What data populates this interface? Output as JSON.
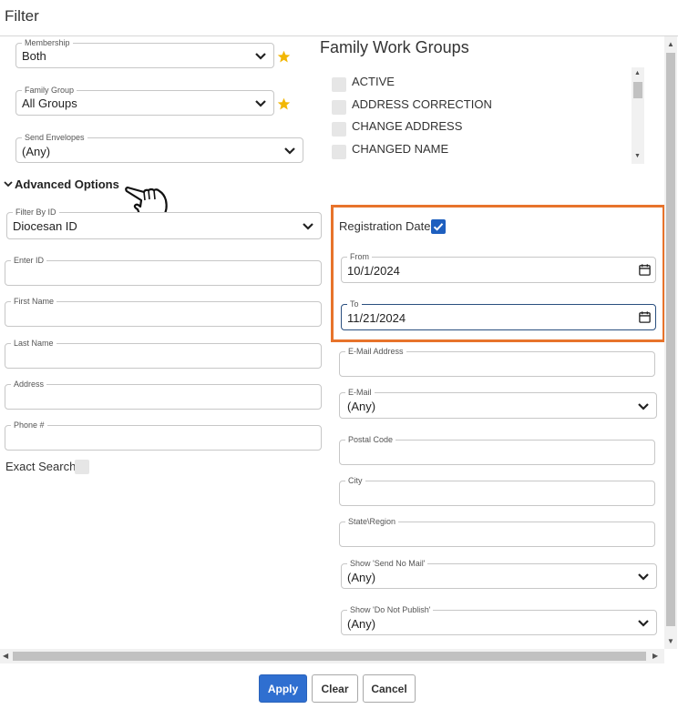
{
  "title": "Filter",
  "left": {
    "membership": {
      "legend": "Membership",
      "value": "Both"
    },
    "family_group": {
      "legend": "Family Group",
      "value": "All Groups"
    },
    "send_envelopes": {
      "legend": "Send Envelopes",
      "value": "(Any)"
    },
    "advanced_options": "Advanced Options",
    "filter_by_id": {
      "legend": "Filter By ID",
      "value": "Diocesan ID"
    },
    "enter_id": {
      "legend": "Enter ID",
      "value": ""
    },
    "first_name": {
      "legend": "First Name",
      "value": ""
    },
    "last_name": {
      "legend": "Last Name",
      "value": ""
    },
    "address": {
      "legend": "Address",
      "value": ""
    },
    "phone": {
      "legend": "Phone #",
      "value": ""
    },
    "exact_search": "Exact Search"
  },
  "work_groups": {
    "heading": "Family Work Groups",
    "items": [
      "ACTIVE",
      "ADDRESS CORRECTION",
      "CHANGE ADDRESS",
      "CHANGED NAME"
    ]
  },
  "right": {
    "registration_date": {
      "label": "Registration Date",
      "checked": true
    },
    "from": {
      "legend": "From",
      "value": "10/1/2024"
    },
    "to": {
      "legend": "To",
      "value": "11/21/2024"
    },
    "email_address": {
      "legend": "E-Mail Address",
      "value": ""
    },
    "email": {
      "legend": "E-Mail",
      "value": "(Any)"
    },
    "postal_code": {
      "legend": "Postal Code",
      "value": ""
    },
    "city": {
      "legend": "City",
      "value": ""
    },
    "state_region": {
      "legend": "State\\Region",
      "value": ""
    },
    "show_send_no_mail": {
      "legend": "Show 'Send No Mail'",
      "value": "(Any)"
    },
    "show_do_not_publish": {
      "legend": "Show 'Do Not Publish'",
      "value": "(Any)"
    }
  },
  "buttons": {
    "apply": "Apply",
    "clear": "Clear",
    "cancel": "Cancel"
  },
  "colors": {
    "accent": "#2f6fd0",
    "highlight": "#e7732b",
    "star": "#f2b705"
  },
  "icons": [
    "chevron-down-icon",
    "star-icon",
    "calendar-icon",
    "check-icon",
    "pointing-hand-cursor-icon"
  ]
}
